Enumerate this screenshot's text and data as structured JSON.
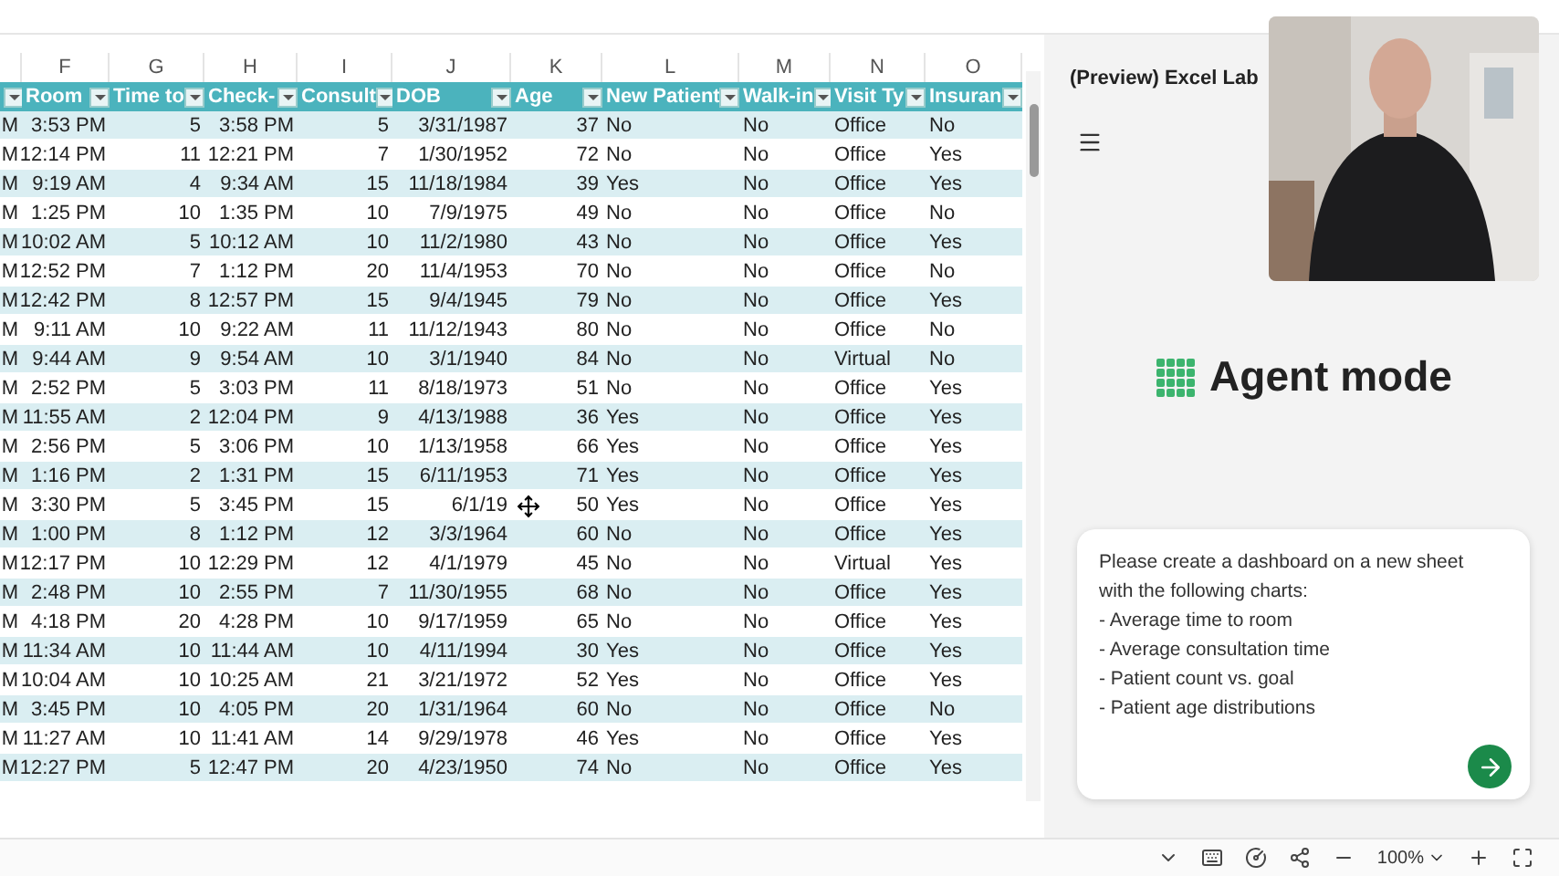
{
  "sheet": {
    "columns": [
      {
        "filter": true
      },
      {
        "letter": "F",
        "label": "Room",
        "filter": true
      },
      {
        "letter": "G",
        "label": "Time to",
        "filter": true
      },
      {
        "letter": "H",
        "label": "Check-",
        "filter": true
      },
      {
        "letter": "I",
        "label": "Consult",
        "filter": true
      },
      {
        "letter": "J",
        "label": "DOB",
        "filter": true
      },
      {
        "letter": "K",
        "label": "Age",
        "filter": true
      },
      {
        "letter": "L",
        "label": "New Patient",
        "filter": true
      },
      {
        "letter": "M",
        "label": "Walk-in",
        "filter": true
      },
      {
        "letter": "N",
        "label": "Visit Ty",
        "filter": true
      },
      {
        "letter": "O",
        "label": "Insuran",
        "filter": true
      }
    ],
    "rows": [
      [
        "M",
        "3:53 PM",
        "5",
        "3:58 PM",
        "5",
        "3/31/1987",
        "37",
        "No",
        "No",
        "Office",
        "No"
      ],
      [
        "M",
        "12:14 PM",
        "11",
        "12:21 PM",
        "7",
        "1/30/1952",
        "72",
        "No",
        "No",
        "Office",
        "Yes"
      ],
      [
        "M",
        "9:19 AM",
        "4",
        "9:34 AM",
        "15",
        "11/18/1984",
        "39",
        "Yes",
        "No",
        "Office",
        "Yes"
      ],
      [
        "M",
        "1:25 PM",
        "10",
        "1:35 PM",
        "10",
        "7/9/1975",
        "49",
        "No",
        "No",
        "Office",
        "No"
      ],
      [
        "M",
        "10:02 AM",
        "5",
        "10:12 AM",
        "10",
        "11/2/1980",
        "43",
        "No",
        "No",
        "Office",
        "Yes"
      ],
      [
        "M",
        "12:52 PM",
        "7",
        "1:12 PM",
        "20",
        "11/4/1953",
        "70",
        "No",
        "No",
        "Office",
        "No"
      ],
      [
        "M",
        "12:42 PM",
        "8",
        "12:57 PM",
        "15",
        "9/4/1945",
        "79",
        "No",
        "No",
        "Office",
        "Yes"
      ],
      [
        "M",
        "9:11 AM",
        "10",
        "9:22 AM",
        "11",
        "11/12/1943",
        "80",
        "No",
        "No",
        "Office",
        "No"
      ],
      [
        "M",
        "9:44 AM",
        "9",
        "9:54 AM",
        "10",
        "3/1/1940",
        "84",
        "No",
        "No",
        "Virtual",
        "No"
      ],
      [
        "M",
        "2:52 PM",
        "5",
        "3:03 PM",
        "11",
        "8/18/1973",
        "51",
        "No",
        "No",
        "Office",
        "Yes"
      ],
      [
        "M",
        "11:55 AM",
        "2",
        "12:04 PM",
        "9",
        "4/13/1988",
        "36",
        "Yes",
        "No",
        "Office",
        "Yes"
      ],
      [
        "M",
        "2:56 PM",
        "5",
        "3:06 PM",
        "10",
        "1/13/1958",
        "66",
        "Yes",
        "No",
        "Office",
        "Yes"
      ],
      [
        "M",
        "1:16 PM",
        "2",
        "1:31 PM",
        "15",
        "6/11/1953",
        "71",
        "Yes",
        "No",
        "Office",
        "Yes"
      ],
      [
        "M",
        "3:30 PM",
        "5",
        "3:45 PM",
        "15",
        "6/1/19",
        "50",
        "Yes",
        "No",
        "Office",
        "Yes"
      ],
      [
        "M",
        "1:00 PM",
        "8",
        "1:12 PM",
        "12",
        "3/3/1964",
        "60",
        "No",
        "No",
        "Office",
        "Yes"
      ],
      [
        "M",
        "12:17 PM",
        "10",
        "12:29 PM",
        "12",
        "4/1/1979",
        "45",
        "No",
        "No",
        "Virtual",
        "Yes"
      ],
      [
        "M",
        "2:48 PM",
        "10",
        "2:55 PM",
        "7",
        "11/30/1955",
        "68",
        "No",
        "No",
        "Office",
        "Yes"
      ],
      [
        "M",
        "4:18 PM",
        "20",
        "4:28 PM",
        "10",
        "9/17/1959",
        "65",
        "No",
        "No",
        "Office",
        "Yes"
      ],
      [
        "M",
        "11:34 AM",
        "10",
        "11:44 AM",
        "10",
        "4/11/1994",
        "30",
        "Yes",
        "No",
        "Office",
        "Yes"
      ],
      [
        "M",
        "10:04 AM",
        "10",
        "10:25 AM",
        "21",
        "3/21/1972",
        "52",
        "Yes",
        "No",
        "Office",
        "Yes"
      ],
      [
        "M",
        "3:45 PM",
        "10",
        "4:05 PM",
        "20",
        "1/31/1964",
        "60",
        "No",
        "No",
        "Office",
        "No"
      ],
      [
        "M",
        "11:27 AM",
        "10",
        "11:41 AM",
        "14",
        "9/29/1978",
        "46",
        "Yes",
        "No",
        "Office",
        "Yes"
      ],
      [
        "M",
        "12:27 PM",
        "5",
        "12:47 PM",
        "20",
        "4/23/1950",
        "74",
        "No",
        "No",
        "Office",
        "Yes"
      ]
    ]
  },
  "pane": {
    "title": "(Preview) Excel Lab",
    "heading": "Agent mode",
    "prompt": [
      "Please create a dashboard on a new sheet",
      "with the following charts:",
      "- Average time to room",
      "- Average consultation time",
      "- Patient count vs. goal",
      "- Patient age distributions"
    ]
  },
  "status_bar": {
    "zoom": "100%"
  }
}
